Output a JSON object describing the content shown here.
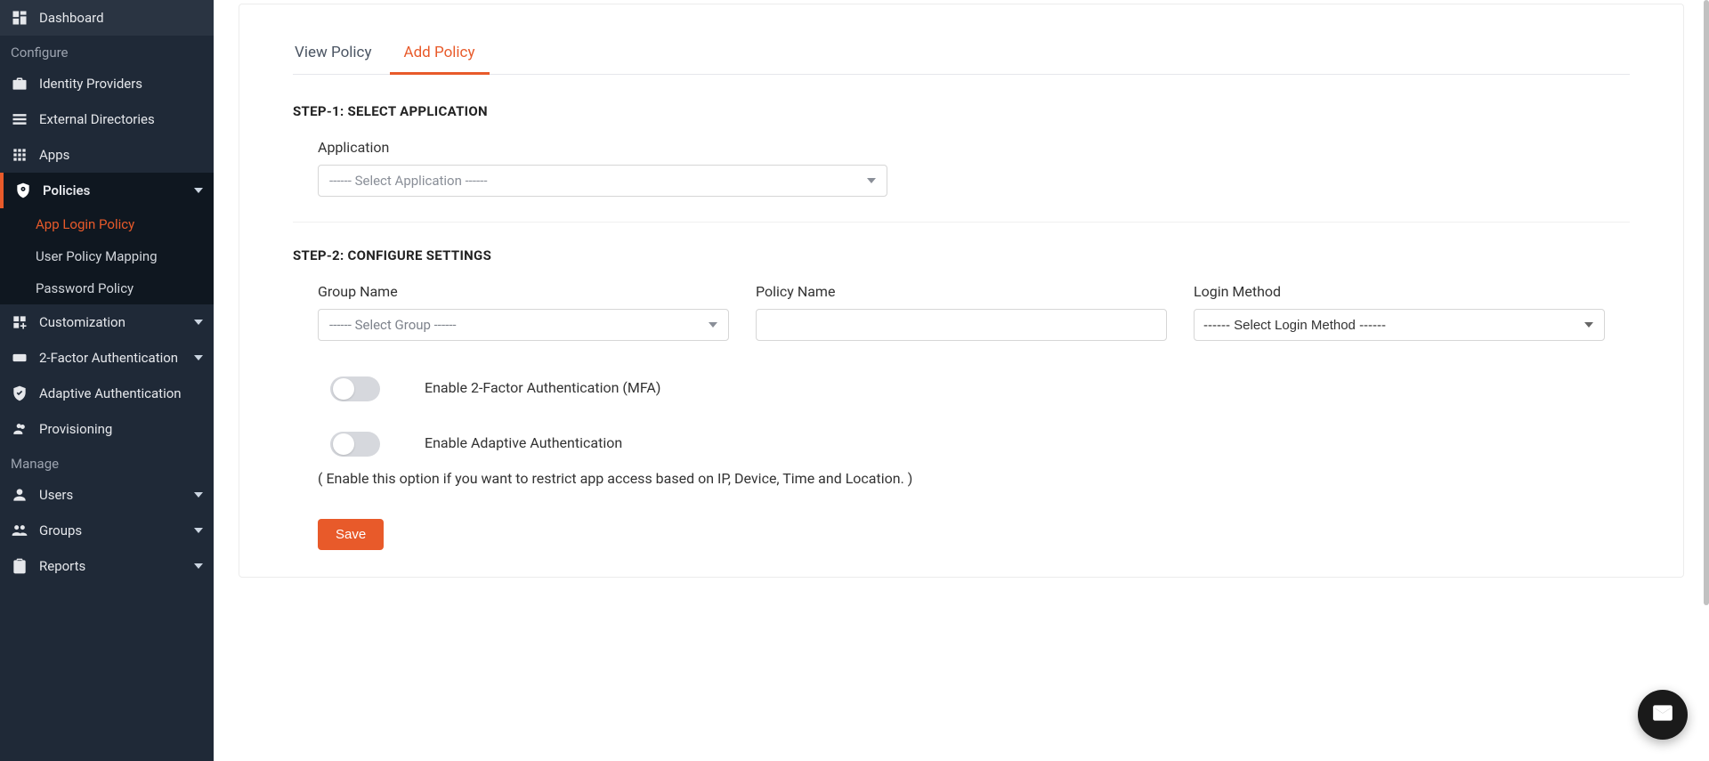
{
  "sidebar": {
    "sections": {
      "configure_label": "Configure",
      "manage_label": "Manage"
    },
    "items": {
      "dashboard": "Dashboard",
      "identity_providers": "Identity Providers",
      "external_directories": "External Directories",
      "apps": "Apps",
      "policies": "Policies",
      "customization": "Customization",
      "two_factor": "2-Factor Authentication",
      "adaptive_auth": "Adaptive Authentication",
      "provisioning": "Provisioning",
      "users": "Users",
      "groups": "Groups",
      "reports": "Reports"
    },
    "policies_sub": {
      "app_login": "App Login Policy",
      "user_mapping": "User Policy Mapping",
      "password": "Password Policy"
    }
  },
  "tabs": {
    "view": "View Policy",
    "add": "Add Policy"
  },
  "step1": {
    "title": "STEP-1: SELECT APPLICATION",
    "application_label": "Application",
    "application_placeholder": "------ Select Application ------"
  },
  "step2": {
    "title": "STEP-2: CONFIGURE SETTINGS",
    "group_label": "Group Name",
    "group_placeholder": "------ Select Group ------",
    "policy_label": "Policy Name",
    "policy_value": "",
    "login_method_label": "Login Method",
    "login_method_placeholder": "------ Select Login Method ------",
    "toggle_mfa_label": "Enable 2-Factor Authentication (MFA)",
    "toggle_adaptive_label": "Enable Adaptive Authentication",
    "toggle_adaptive_hint": "( Enable this option if you want to restrict app access based on IP, Device, Time and Location. )"
  },
  "buttons": {
    "save": "Save"
  }
}
